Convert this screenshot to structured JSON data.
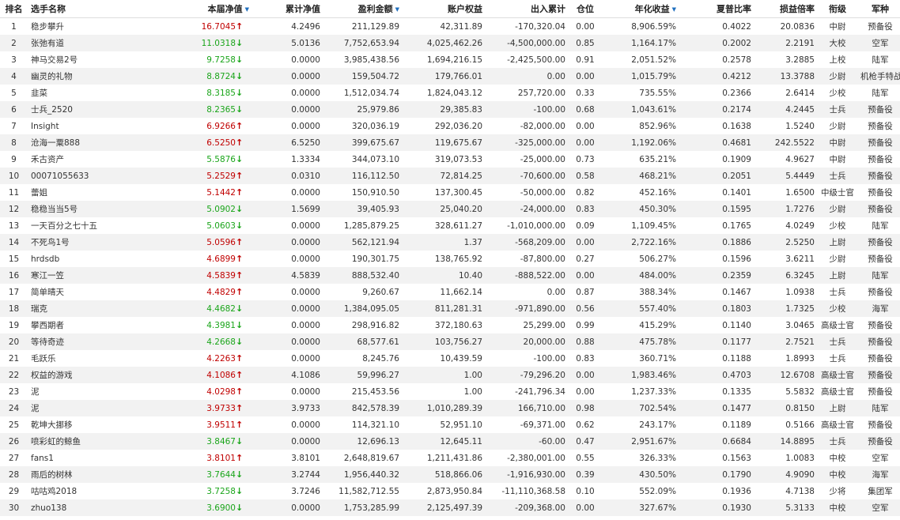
{
  "colors": {
    "up": "#c00000",
    "down": "#1aa51a",
    "stripe": "#f2f2f2",
    "sort": "#1f6fbf"
  },
  "sort_icon": "sort-down-triangle-icon",
  "headers": {
    "rank": "排名",
    "name": "选手名称",
    "nav": "本届净值",
    "cum_nav": "累计净值",
    "profit": "盈利金额",
    "equity": "账户权益",
    "flow": "出入累计",
    "position": "仓位",
    "annual": "年化收益",
    "sharpe": "夏普比率",
    "pl_ratio": "损益倍率",
    "rank_title": "衔级",
    "branch": "军种"
  },
  "rows": [
    {
      "rank": "1",
      "name": "稳步攀升",
      "nav": "16.7045",
      "dir": "up",
      "cum_nav": "4.2496",
      "profit": "211,129.89",
      "equity": "42,311.89",
      "flow": "-170,320.04",
      "position": "0.00",
      "annual": "8,906.59%",
      "sharpe": "0.4022",
      "pl_ratio": "20.0836",
      "title": "中尉",
      "branch": "预备役"
    },
    {
      "rank": "2",
      "name": "张弛有道",
      "nav": "11.0318",
      "dir": "down",
      "cum_nav": "5.0136",
      "profit": "7,752,653.94",
      "equity": "4,025,462.26",
      "flow": "-4,500,000.00",
      "position": "0.85",
      "annual": "1,164.17%",
      "sharpe": "0.2002",
      "pl_ratio": "2.2191",
      "title": "大校",
      "branch": "空军"
    },
    {
      "rank": "3",
      "name": "神马交易2号",
      "nav": "9.7258",
      "dir": "down",
      "cum_nav": "0.0000",
      "profit": "3,985,438.56",
      "equity": "1,694,216.15",
      "flow": "-2,425,500.00",
      "position": "0.91",
      "annual": "2,051.52%",
      "sharpe": "0.2578",
      "pl_ratio": "3.2885",
      "title": "上校",
      "branch": "陆军"
    },
    {
      "rank": "4",
      "name": "幽灵的礼物",
      "nav": "8.8724",
      "dir": "down",
      "cum_nav": "0.0000",
      "profit": "159,504.72",
      "equity": "179,766.01",
      "flow": "0.00",
      "position": "0.00",
      "annual": "1,015.79%",
      "sharpe": "0.4212",
      "pl_ratio": "13.3788",
      "title": "少尉",
      "branch": "机枪手特战营"
    },
    {
      "rank": "5",
      "name": "韭菜",
      "nav": "8.3185",
      "dir": "down",
      "cum_nav": "0.0000",
      "profit": "1,512,034.74",
      "equity": "1,824,043.12",
      "flow": "257,720.00",
      "position": "0.33",
      "annual": "735.55%",
      "sharpe": "0.2366",
      "pl_ratio": "2.6414",
      "title": "少校",
      "branch": "陆军"
    },
    {
      "rank": "6",
      "name": "士兵_2520",
      "nav": "8.2365",
      "dir": "down",
      "cum_nav": "0.0000",
      "profit": "25,979.86",
      "equity": "29,385.83",
      "flow": "-100.00",
      "position": "0.68",
      "annual": "1,043.61%",
      "sharpe": "0.2174",
      "pl_ratio": "4.2445",
      "title": "士兵",
      "branch": "预备役"
    },
    {
      "rank": "7",
      "name": "Insight",
      "nav": "6.9266",
      "dir": "up",
      "cum_nav": "0.0000",
      "profit": "320,036.19",
      "equity": "292,036.20",
      "flow": "-82,000.00",
      "position": "0.00",
      "annual": "852.96%",
      "sharpe": "0.1638",
      "pl_ratio": "1.5240",
      "title": "少尉",
      "branch": "预备役"
    },
    {
      "rank": "8",
      "name": "沧海一粟888",
      "nav": "6.5250",
      "dir": "up",
      "cum_nav": "6.5250",
      "profit": "399,675.67",
      "equity": "119,675.67",
      "flow": "-325,000.00",
      "position": "0.00",
      "annual": "1,192.06%",
      "sharpe": "0.4681",
      "pl_ratio": "242.5522",
      "title": "中尉",
      "branch": "预备役"
    },
    {
      "rank": "9",
      "name": "禾古资产",
      "nav": "5.5876",
      "dir": "down",
      "cum_nav": "1.3334",
      "profit": "344,073.10",
      "equity": "319,073.53",
      "flow": "-25,000.00",
      "position": "0.73",
      "annual": "635.21%",
      "sharpe": "0.1909",
      "pl_ratio": "4.9627",
      "title": "中尉",
      "branch": "预备役"
    },
    {
      "rank": "10",
      "name": "00071055633",
      "nav": "5.2529",
      "dir": "up",
      "cum_nav": "0.0310",
      "profit": "116,112.50",
      "equity": "72,814.25",
      "flow": "-70,600.00",
      "position": "0.58",
      "annual": "468.21%",
      "sharpe": "0.2051",
      "pl_ratio": "5.4449",
      "title": "士兵",
      "branch": "预备役"
    },
    {
      "rank": "11",
      "name": "蕾姐",
      "nav": "5.1442",
      "dir": "up",
      "cum_nav": "0.0000",
      "profit": "150,910.50",
      "equity": "137,300.45",
      "flow": "-50,000.00",
      "position": "0.82",
      "annual": "452.16%",
      "sharpe": "0.1401",
      "pl_ratio": "1.6500",
      "title": "中级士官",
      "branch": "预备役"
    },
    {
      "rank": "12",
      "name": "稳稳当当5号",
      "nav": "5.0902",
      "dir": "down",
      "cum_nav": "1.5699",
      "profit": "39,405.93",
      "equity": "25,040.20",
      "flow": "-24,000.00",
      "position": "0.83",
      "annual": "450.30%",
      "sharpe": "0.1595",
      "pl_ratio": "1.7276",
      "title": "少尉",
      "branch": "预备役"
    },
    {
      "rank": "13",
      "name": "一天百分之七十五",
      "nav": "5.0603",
      "dir": "down",
      "cum_nav": "0.0000",
      "profit": "1,285,879.25",
      "equity": "328,611.27",
      "flow": "-1,010,000.00",
      "position": "0.09",
      "annual": "1,109.45%",
      "sharpe": "0.1765",
      "pl_ratio": "4.0249",
      "title": "少校",
      "branch": "陆军"
    },
    {
      "rank": "14",
      "name": "不死鸟1号",
      "nav": "5.0596",
      "dir": "up",
      "cum_nav": "0.0000",
      "profit": "562,121.94",
      "equity": "1.37",
      "flow": "-568,209.00",
      "position": "0.00",
      "annual": "2,722.16%",
      "sharpe": "0.1886",
      "pl_ratio": "2.5250",
      "title": "上尉",
      "branch": "预备役"
    },
    {
      "rank": "15",
      "name": "hrdsdb",
      "nav": "4.6899",
      "dir": "up",
      "cum_nav": "0.0000",
      "profit": "190,301.75",
      "equity": "138,765.92",
      "flow": "-87,800.00",
      "position": "0.27",
      "annual": "506.27%",
      "sharpe": "0.1596",
      "pl_ratio": "3.6211",
      "title": "少尉",
      "branch": "预备役"
    },
    {
      "rank": "16",
      "name": "寒江一笠",
      "nav": "4.5839",
      "dir": "up",
      "cum_nav": "4.5839",
      "profit": "888,532.40",
      "equity": "10.40",
      "flow": "-888,522.00",
      "position": "0.00",
      "annual": "484.00%",
      "sharpe": "0.2359",
      "pl_ratio": "6.3245",
      "title": "上尉",
      "branch": "陆军"
    },
    {
      "rank": "17",
      "name": "简单晴天",
      "nav": "4.4829",
      "dir": "up",
      "cum_nav": "0.0000",
      "profit": "9,260.67",
      "equity": "11,662.14",
      "flow": "0.00",
      "position": "0.87",
      "annual": "388.34%",
      "sharpe": "0.1467",
      "pl_ratio": "1.0938",
      "title": "士兵",
      "branch": "预备役"
    },
    {
      "rank": "18",
      "name": "瑞克",
      "nav": "4.4682",
      "dir": "down",
      "cum_nav": "0.0000",
      "profit": "1,384,095.05",
      "equity": "811,281.31",
      "flow": "-971,890.00",
      "position": "0.56",
      "annual": "557.40%",
      "sharpe": "0.1803",
      "pl_ratio": "1.7325",
      "title": "少校",
      "branch": "海军"
    },
    {
      "rank": "19",
      "name": "攀西期者",
      "nav": "4.3981",
      "dir": "down",
      "cum_nav": "0.0000",
      "profit": "298,916.82",
      "equity": "372,180.63",
      "flow": "25,299.00",
      "position": "0.99",
      "annual": "415.29%",
      "sharpe": "0.1140",
      "pl_ratio": "3.0465",
      "title": "高级士官",
      "branch": "预备役"
    },
    {
      "rank": "20",
      "name": "等待奇迹",
      "nav": "4.2668",
      "dir": "down",
      "cum_nav": "0.0000",
      "profit": "68,577.61",
      "equity": "103,756.27",
      "flow": "20,000.00",
      "position": "0.88",
      "annual": "475.78%",
      "sharpe": "0.1177",
      "pl_ratio": "2.7521",
      "title": "士兵",
      "branch": "预备役"
    },
    {
      "rank": "21",
      "name": "毛跃乐",
      "nav": "4.2263",
      "dir": "up",
      "cum_nav": "0.0000",
      "profit": "8,245.76",
      "equity": "10,439.59",
      "flow": "-100.00",
      "position": "0.83",
      "annual": "360.71%",
      "sharpe": "0.1188",
      "pl_ratio": "1.8993",
      "title": "士兵",
      "branch": "预备役"
    },
    {
      "rank": "22",
      "name": "权益的游戏",
      "nav": "4.1086",
      "dir": "up",
      "cum_nav": "4.1086",
      "profit": "59,996.27",
      "equity": "1.00",
      "flow": "-79,296.20",
      "position": "0.00",
      "annual": "1,983.46%",
      "sharpe": "0.4703",
      "pl_ratio": "12.6708",
      "title": "高级士官",
      "branch": "预备役"
    },
    {
      "rank": "23",
      "name": "泥",
      "nav": "4.0298",
      "dir": "up",
      "cum_nav": "0.0000",
      "profit": "215,453.56",
      "equity": "1.00",
      "flow": "-241,796.34",
      "position": "0.00",
      "annual": "1,237.33%",
      "sharpe": "0.1335",
      "pl_ratio": "5.5832",
      "title": "高级士官",
      "branch": "预备役"
    },
    {
      "rank": "24",
      "name": "泥",
      "nav": "3.9733",
      "dir": "up",
      "cum_nav": "3.9733",
      "profit": "842,578.39",
      "equity": "1,010,289.39",
      "flow": "166,710.00",
      "position": "0.98",
      "annual": "702.54%",
      "sharpe": "0.1477",
      "pl_ratio": "0.8150",
      "title": "上尉",
      "branch": "陆军"
    },
    {
      "rank": "25",
      "name": "乾坤大挪移",
      "nav": "3.9511",
      "dir": "up",
      "cum_nav": "0.0000",
      "profit": "114,321.10",
      "equity": "52,951.10",
      "flow": "-69,371.00",
      "position": "0.62",
      "annual": "243.17%",
      "sharpe": "0.1189",
      "pl_ratio": "0.5166",
      "title": "高级士官",
      "branch": "预备役"
    },
    {
      "rank": "26",
      "name": "喷彩虹的鲸鱼",
      "nav": "3.8467",
      "dir": "down",
      "cum_nav": "0.0000",
      "profit": "12,696.13",
      "equity": "12,645.11",
      "flow": "-60.00",
      "position": "0.47",
      "annual": "2,951.67%",
      "sharpe": "0.6684",
      "pl_ratio": "14.8895",
      "title": "士兵",
      "branch": "预备役"
    },
    {
      "rank": "27",
      "name": "fans1",
      "nav": "3.8101",
      "dir": "up",
      "cum_nav": "3.8101",
      "profit": "2,648,819.67",
      "equity": "1,211,431.86",
      "flow": "-2,380,001.00",
      "position": "0.55",
      "annual": "326.33%",
      "sharpe": "0.1563",
      "pl_ratio": "1.0083",
      "title": "中校",
      "branch": "空军"
    },
    {
      "rank": "28",
      "name": "雨后的树林",
      "nav": "3.7644",
      "dir": "down",
      "cum_nav": "3.2744",
      "profit": "1,956,440.32",
      "equity": "518,866.06",
      "flow": "-1,916,930.00",
      "position": "0.39",
      "annual": "430.50%",
      "sharpe": "0.1790",
      "pl_ratio": "4.9090",
      "title": "中校",
      "branch": "海军"
    },
    {
      "rank": "29",
      "name": "咕咕鸡2018",
      "nav": "3.7258",
      "dir": "down",
      "cum_nav": "3.7246",
      "profit": "11,582,712.55",
      "equity": "2,873,950.84",
      "flow": "-11,110,368.58",
      "position": "0.10",
      "annual": "552.09%",
      "sharpe": "0.1936",
      "pl_ratio": "4.7138",
      "title": "少将",
      "branch": "集团军"
    },
    {
      "rank": "30",
      "name": "zhuo138",
      "nav": "3.6900",
      "dir": "down",
      "cum_nav": "0.0000",
      "profit": "1,753,285.99",
      "equity": "2,125,497.39",
      "flow": "-209,368.00",
      "position": "0.00",
      "annual": "327.67%",
      "sharpe": "0.1930",
      "pl_ratio": "5.3133",
      "title": "中校",
      "branch": "空军"
    }
  ]
}
